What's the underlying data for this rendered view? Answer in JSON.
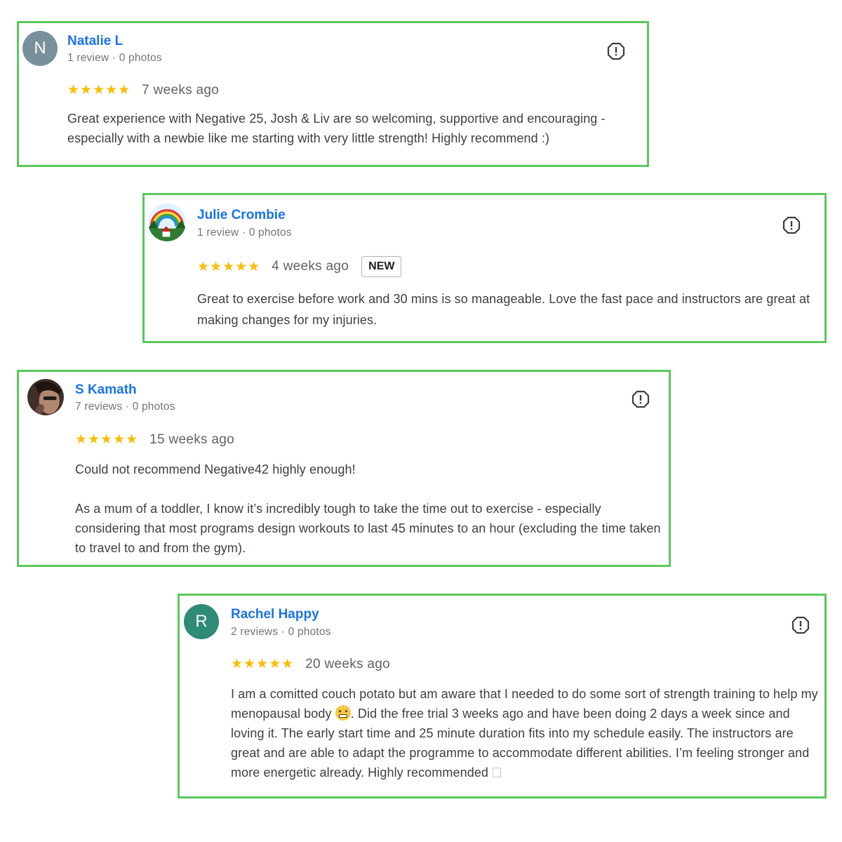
{
  "reviews": [
    {
      "avatar_letter": "N",
      "avatar_color": "#78909c",
      "name": "Natalie L",
      "meta": "1 review · 0 photos",
      "stars": "★★★★★",
      "rating": 5,
      "time": "7 weeks ago",
      "text": "Great experience with Negative 25, Josh & Liv are so welcoming, supportive and encouraging - especially with a newbie like me starting with very little strength! Highly recommend :)"
    },
    {
      "name": "Julie Crombie",
      "meta": "1 review · 0 photos",
      "stars": "★★★★★",
      "rating": 5,
      "time": "4 weeks ago",
      "badge": "NEW",
      "text": "Great to exercise before work and 30 mins is so manageable. Love the fast pace and instructors are great at making changes for my injuries."
    },
    {
      "name": "S Kamath",
      "meta": "7 reviews · 0 photos",
      "stars": "★★★★★",
      "rating": 5,
      "time": "15 weeks ago",
      "text_1": "Could not recommend Negative42 highly enough!",
      "text_2": "As a mum of a toddler, I know it’s incredibly tough to take the time out to exercise - especially considering that most programs design workouts to last 45 minutes to an hour (excluding the time taken to travel to and from the gym)."
    },
    {
      "avatar_letter": "R",
      "avatar_color": "#2e8b76",
      "name": "Rachel Happy",
      "meta": "2 reviews · 0 photos",
      "stars": "★★★★★",
      "rating": 5,
      "time": "20 weeks ago",
      "text_before_emoji": "I am a comitted couch potato but am aware that I needed to do some sort of strength training to help my menopausal body",
      "text_after_emoji": ". Did the free trial 3 weeks ago and have been doing 2 days a week since and loving it. The early start time and 25 minute duration fits into my schedule easily. The instructors are great and are able to adapt the programme to accommodate different abilities. I’m feeling stronger and more energetic already. Highly recommended"
    }
  ],
  "colors": {
    "card_border": "#5ac85a",
    "name_link": "#1a73e8",
    "stars": "#fbbc04"
  },
  "icons": {
    "report": "report-flag-icon",
    "emoji": "grimacing-face-emoji",
    "missing_glyph": "missing-glyph-icon"
  }
}
